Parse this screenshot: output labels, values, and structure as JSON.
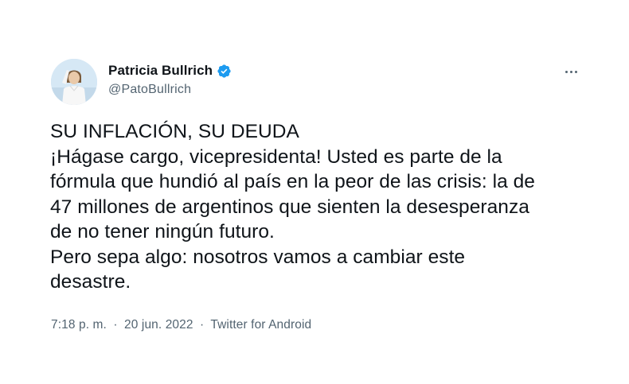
{
  "author": {
    "display_name": "Patricia Bullrich",
    "handle": "@PatoBullrich",
    "verified": true
  },
  "tweet": {
    "lines": [
      "SU INFLACIÓN, SU DEUDA",
      "¡Hágase cargo, vicepresidenta! Usted es parte de la",
      "fórmula que hundió al país en la peor de las crisis: la de",
      "47 millones de argentinos que sienten la desesperanza",
      "de no tener ningún futuro.",
      "Pero sepa algo: nosotros vamos a cambiar este",
      "desastre."
    ]
  },
  "meta": {
    "time": "7:18 p. m.",
    "separator": "·",
    "date": "20 jun. 2022",
    "source": "Twitter for Android"
  },
  "icons": {
    "verified": "verified-badge-icon",
    "more": "more-options-icon"
  },
  "colors": {
    "text_primary": "#0f1419",
    "text_secondary": "#536471",
    "verified_blue": "#1d9bf0"
  }
}
